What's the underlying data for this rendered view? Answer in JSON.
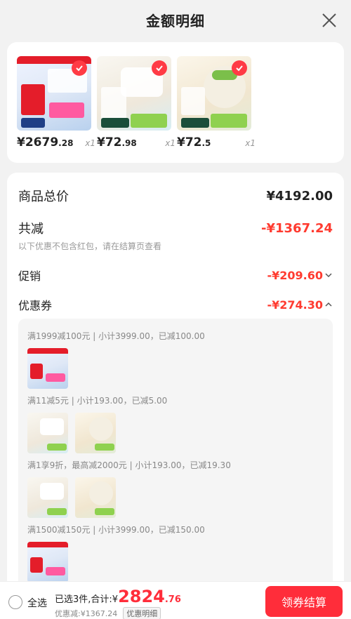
{
  "header": {
    "title": "金额明细"
  },
  "products": [
    {
      "price_int": "¥2679",
      "price_dec": ".28",
      "qty": "x1"
    },
    {
      "price_int": "¥72",
      "price_dec": ".98",
      "qty": "x1"
    },
    {
      "price_int": "¥72",
      "price_dec": ".5",
      "qty": "x1"
    }
  ],
  "detail": {
    "goods_total_label": "商品总价",
    "goods_total_value": "¥4192.00",
    "reduce_label": "共减",
    "reduce_value": "-¥1367.24",
    "reduce_note": "以下优惠不包含红包，请在结算页查看",
    "promo_label": "促销",
    "promo_value": "-¥209.60",
    "coupon_label": "优惠券",
    "coupon_value": "-¥274.30"
  },
  "coupons": [
    "满1999减100元 | 小计3999.00，已减100.00",
    "满11减5元 | 小计193.00，已减5.00",
    "满1享9折，最高减2000元 | 小计193.00，已减19.30",
    "满1500减150元 | 小计3999.00，已减150.00"
  ],
  "bottom": {
    "select_all": "全选",
    "summary_prefix": "已选3件,合计:¥",
    "total_int": "2824",
    "total_dec": ".76",
    "discount_text": "优惠减:¥1367.24",
    "detail_tag": "优惠明细",
    "checkout_label": "领券结算"
  },
  "colors": {
    "accent": "#ff2d3a",
    "price_red": "#ff3b30",
    "background": "#f2f2f2"
  },
  "icons": {
    "close": "close-icon",
    "check": "check-icon",
    "expand": "chevron-down-icon",
    "collapse": "chevron-up-icon",
    "radio": "radio-icon"
  }
}
